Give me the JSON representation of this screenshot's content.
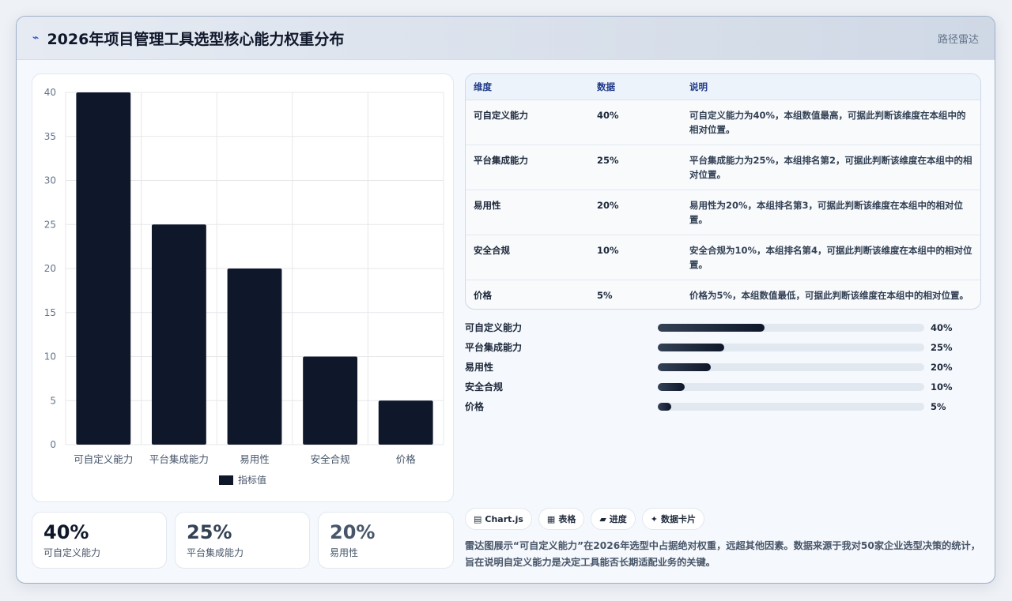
{
  "header": {
    "title": "2026年项目管理工具选型核心能力权重分布",
    "tag": "路径雷达"
  },
  "chart_data": {
    "type": "bar",
    "categories": [
      "可自定义能力",
      "平台集成能力",
      "易用性",
      "安全合规",
      "价格"
    ],
    "series": [
      {
        "name": "指标值",
        "values": [
          40,
          25,
          20,
          10,
          5
        ]
      }
    ],
    "ylim": [
      0,
      40
    ],
    "yticks": [
      0,
      5,
      10,
      15,
      20,
      25,
      30,
      35,
      40
    ],
    "grid": true,
    "legend_position": "bottom",
    "bar_color": "#0f172a"
  },
  "stats": [
    {
      "value": "40%",
      "label": "可自定义能力"
    },
    {
      "value": "25%",
      "label": "平台集成能力"
    },
    {
      "value": "20%",
      "label": "易用性"
    }
  ],
  "table": {
    "headers": [
      "维度",
      "数据",
      "说明"
    ],
    "rows": [
      [
        "可自定义能力",
        "40%",
        "可自定义能力为40%，本组数值最高，可据此判断该维度在本组中的相对位置。"
      ],
      [
        "平台集成能力",
        "25%",
        "平台集成能力为25%，本组排名第2，可据此判断该维度在本组中的相对位置。"
      ],
      [
        "易用性",
        "20%",
        "易用性为20%，本组排名第3，可据此判断该维度在本组中的相对位置。"
      ],
      [
        "安全合规",
        "10%",
        "安全合规为10%，本组排名第4，可据此判断该维度在本组中的相对位置。"
      ],
      [
        "价格",
        "5%",
        "价格为5%，本组数值最低，可据此判断该维度在本组中的相对位置。"
      ]
    ]
  },
  "progress": [
    {
      "label": "可自定义能力",
      "value": 40,
      "text": "40%"
    },
    {
      "label": "平台集成能力",
      "value": 25,
      "text": "25%"
    },
    {
      "label": "易用性",
      "value": 20,
      "text": "20%"
    },
    {
      "label": "安全合规",
      "value": 10,
      "text": "10%"
    },
    {
      "label": "价格",
      "value": 5,
      "text": "5%"
    }
  ],
  "chips": [
    {
      "icon": "chart-icon",
      "glyph": "▤",
      "label": "Chart.js"
    },
    {
      "icon": "table-icon",
      "glyph": "▦",
      "label": "表格"
    },
    {
      "icon": "progress-icon",
      "glyph": "▰",
      "label": "进度"
    },
    {
      "icon": "card-icon",
      "glyph": "✦",
      "label": "数据卡片"
    }
  ],
  "note": "雷达图展示“可自定义能力”在2026年选型中占据绝对权重，远超其他因素。数据来源于我对50家企业选型决策的统计，旨在说明自定义能力是决定工具能否长期适配业务的关键。"
}
